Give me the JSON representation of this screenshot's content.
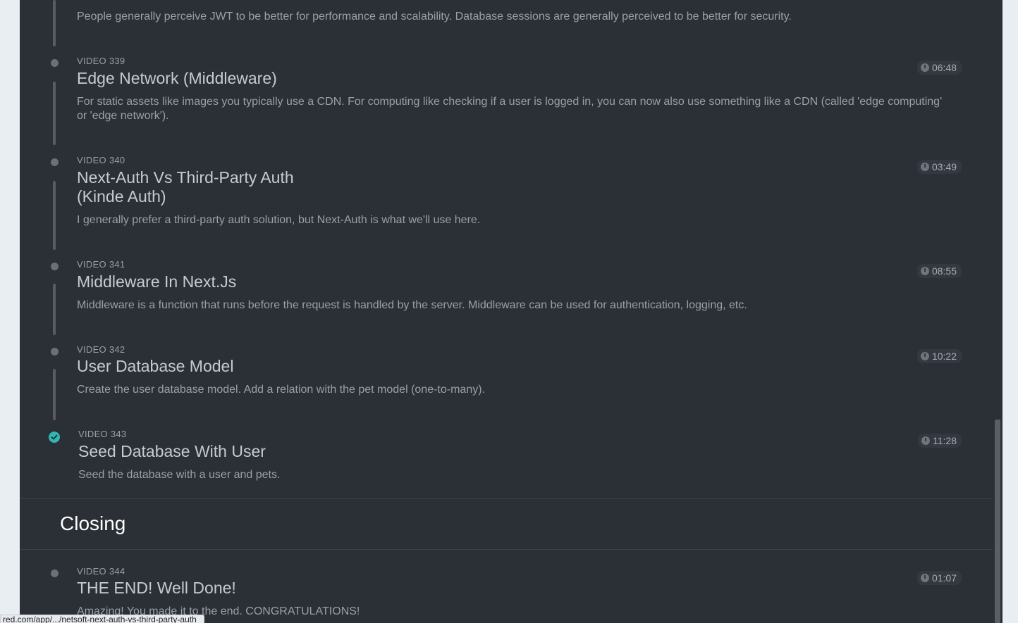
{
  "lessons": [
    {
      "kicker": "",
      "title": "",
      "description": "People generally perceive JWT to be better for performance and scalability. Database sessions are generally perceived to be better for security.",
      "duration": ""
    },
    {
      "kicker": "VIDEO 339",
      "title": "Edge Network (Middleware)",
      "description": "For static assets like images you typically use a CDN. For computing like checking if a user is logged in, you can now also use something like a CDN (called 'edge computing' or 'edge network').",
      "duration": "06:48"
    },
    {
      "kicker": "VIDEO 340",
      "title": "Next-Auth Vs Third-Party Auth (Kinde Auth)",
      "description": "I generally prefer a third-party auth solution, but Next-Auth is what we'll use here.",
      "duration": "03:49"
    },
    {
      "kicker": "VIDEO 341",
      "title": "Middleware In Next.Js",
      "description": "Middleware is a function that runs before the request is handled by the server. Middleware can be used for authentication, logging, etc.",
      "duration": "08:55"
    },
    {
      "kicker": "VIDEO 342",
      "title": "User Database Model",
      "description": "Create the user database model. Add a relation with the pet model (one-to-many).",
      "duration": "10:22"
    },
    {
      "kicker": "VIDEO 343",
      "title": "Seed Database With User",
      "description": "Seed the database with a user and pets.",
      "duration": "11:28",
      "completed": true
    },
    {
      "kicker": "VIDEO 344",
      "title": "THE END! Well Done!",
      "description": "Amazing! You made it to the end. CONGRATULATIONS!",
      "duration": "01:07"
    }
  ],
  "section": {
    "heading": "Closing"
  },
  "status_bar": {
    "url": "red.com/app/.../netsoft-next-auth-vs-third-party-auth"
  },
  "colors": {
    "panel_bg": "#2b2f36",
    "page_bg": "#e9eef3",
    "completed_check": "#2fb6b6"
  }
}
